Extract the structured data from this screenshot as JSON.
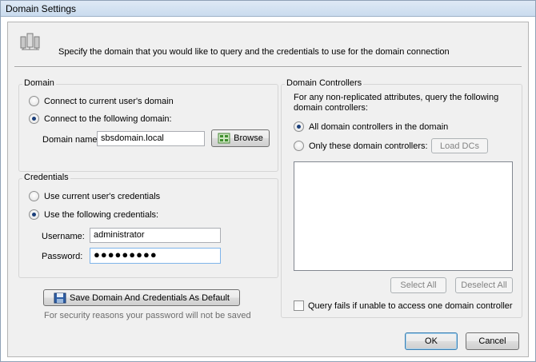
{
  "window": {
    "title": "Domain Settings"
  },
  "header": {
    "text": "Specify the domain that you would like to query and the credentials to use for the domain connection"
  },
  "domain_group": {
    "title": "Domain",
    "option_current": "Connect to current user's domain",
    "option_following": "Connect to the following domain:",
    "selected": "following",
    "domain_name_label": "Domain name:",
    "domain_name_value": "sbsdomain.local",
    "browse_label": "Browse"
  },
  "credentials_group": {
    "title": "Credentials",
    "option_current": "Use current user's credentials",
    "option_following": "Use the following credentials:",
    "selected": "following",
    "username_label": "Username:",
    "username_value": "administrator",
    "password_label": "Password:",
    "password_value": "●●●●●●●●●"
  },
  "save_default": {
    "button_label": "Save Domain And Credentials As Default",
    "note": "For security reasons your password will not be saved"
  },
  "dc_group": {
    "title": "Domain Controllers",
    "description": "For any non-replicated attributes, query the following domain controllers:",
    "option_all": "All domain controllers in the domain",
    "option_only": "Only these domain controllers:",
    "selected": "all",
    "load_dcs_label": "Load DCs",
    "select_all_label": "Select All",
    "deselect_all_label": "Deselect All",
    "query_fails_label": "Query fails if unable to access one domain controller",
    "query_fails_checked": false
  },
  "footer": {
    "ok_label": "OK",
    "cancel_label": "Cancel"
  }
}
